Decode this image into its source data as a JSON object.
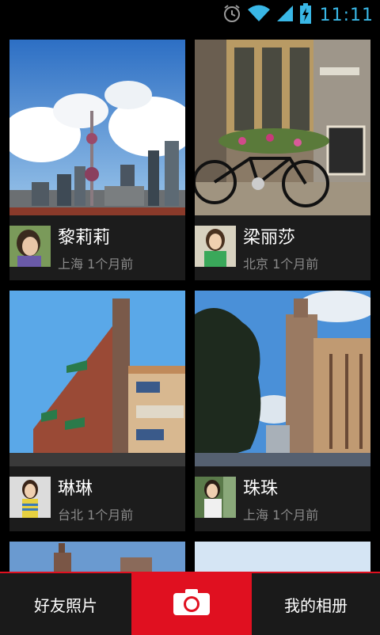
{
  "status_bar": {
    "time": "11:11",
    "icons": [
      "alarm-icon",
      "wifi-icon",
      "signal-icon",
      "battery-charging-icon"
    ],
    "accent_color": "#39b7e6"
  },
  "feed": {
    "cards": [
      {
        "name": "黎莉莉",
        "meta": "上海 1个月前"
      },
      {
        "name": "梁丽莎",
        "meta": "北京 1个月前"
      },
      {
        "name": "琳琳",
        "meta": "台北 1个月前"
      },
      {
        "name": "珠珠",
        "meta": "上海 1个月前"
      }
    ]
  },
  "bottom_bar": {
    "friends_label": "好友照片",
    "camera_icon": "camera-icon",
    "album_label": "我的相册",
    "accent_color": "#e01020"
  }
}
